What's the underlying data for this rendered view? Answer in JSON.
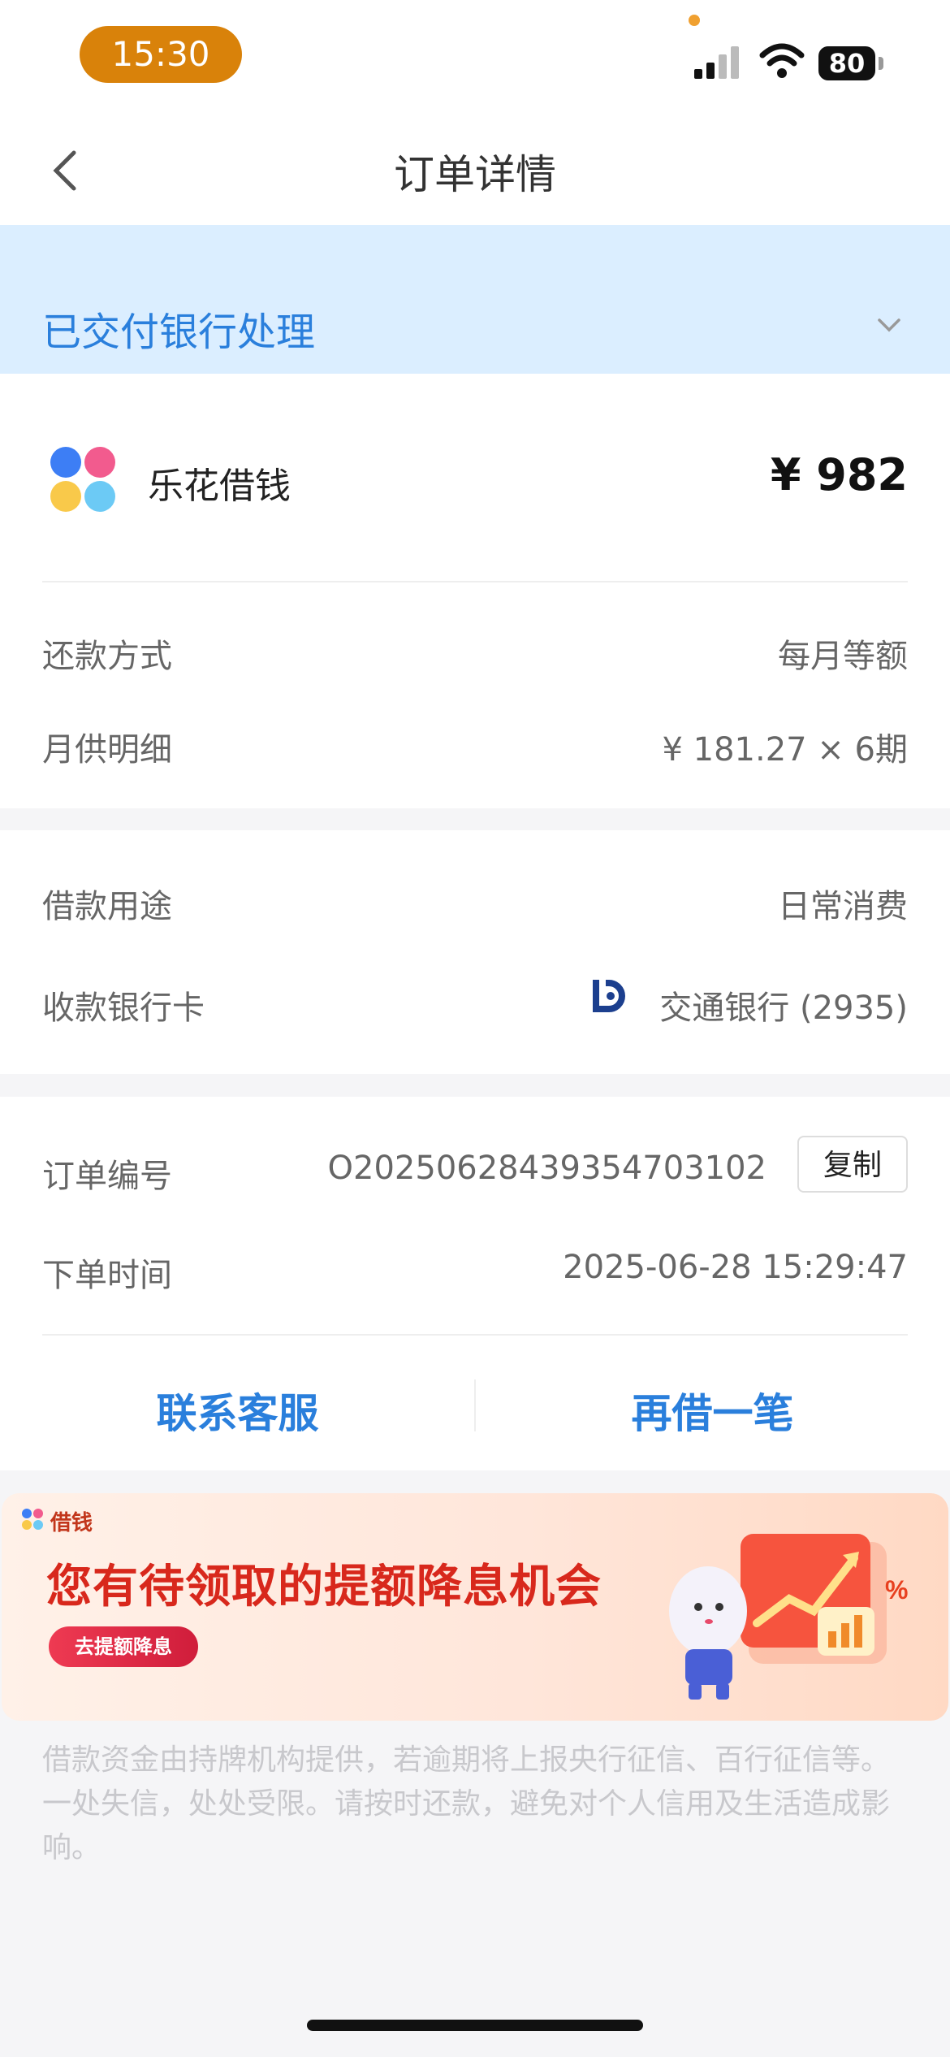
{
  "status_bar": {
    "time": "15:30",
    "battery": "80"
  },
  "nav": {
    "title": "订单详情"
  },
  "order_status": {
    "text": "已交付银行处理"
  },
  "product": {
    "name": "乐花借钱",
    "amount": "¥ 982"
  },
  "repayment": {
    "method_label": "还款方式",
    "method_value": "每月等额",
    "monthly_label": "月供明细",
    "monthly_value": "¥ 181.27 × 6期"
  },
  "loan": {
    "purpose_label": "借款用途",
    "purpose_value": "日常消费",
    "card_label": "收款银行卡",
    "card_value": "交通银行 (2935)"
  },
  "order": {
    "id_label": "订单编号",
    "id_value": "O20250628439354703102",
    "copy_label": "复制",
    "time_label": "下单时间",
    "time_value": "2025-06-28 15:29:47"
  },
  "actions": {
    "contact": "联系客服",
    "borrow_again": "再借一笔"
  },
  "promo": {
    "brand": "借钱",
    "title": "您有待领取的提额降息机会",
    "button": "去提额降息"
  },
  "disclaimer": "借款资金由持牌机构提供，若逾期将上报央行征信、百行征信等。一处失信，处处受限。请按时还款，避免对个人信用及生活造成影响。",
  "colors": {
    "accent": "#2a7fdc",
    "status_bg": "#dbeeff",
    "promo_red": "#d8281c"
  }
}
